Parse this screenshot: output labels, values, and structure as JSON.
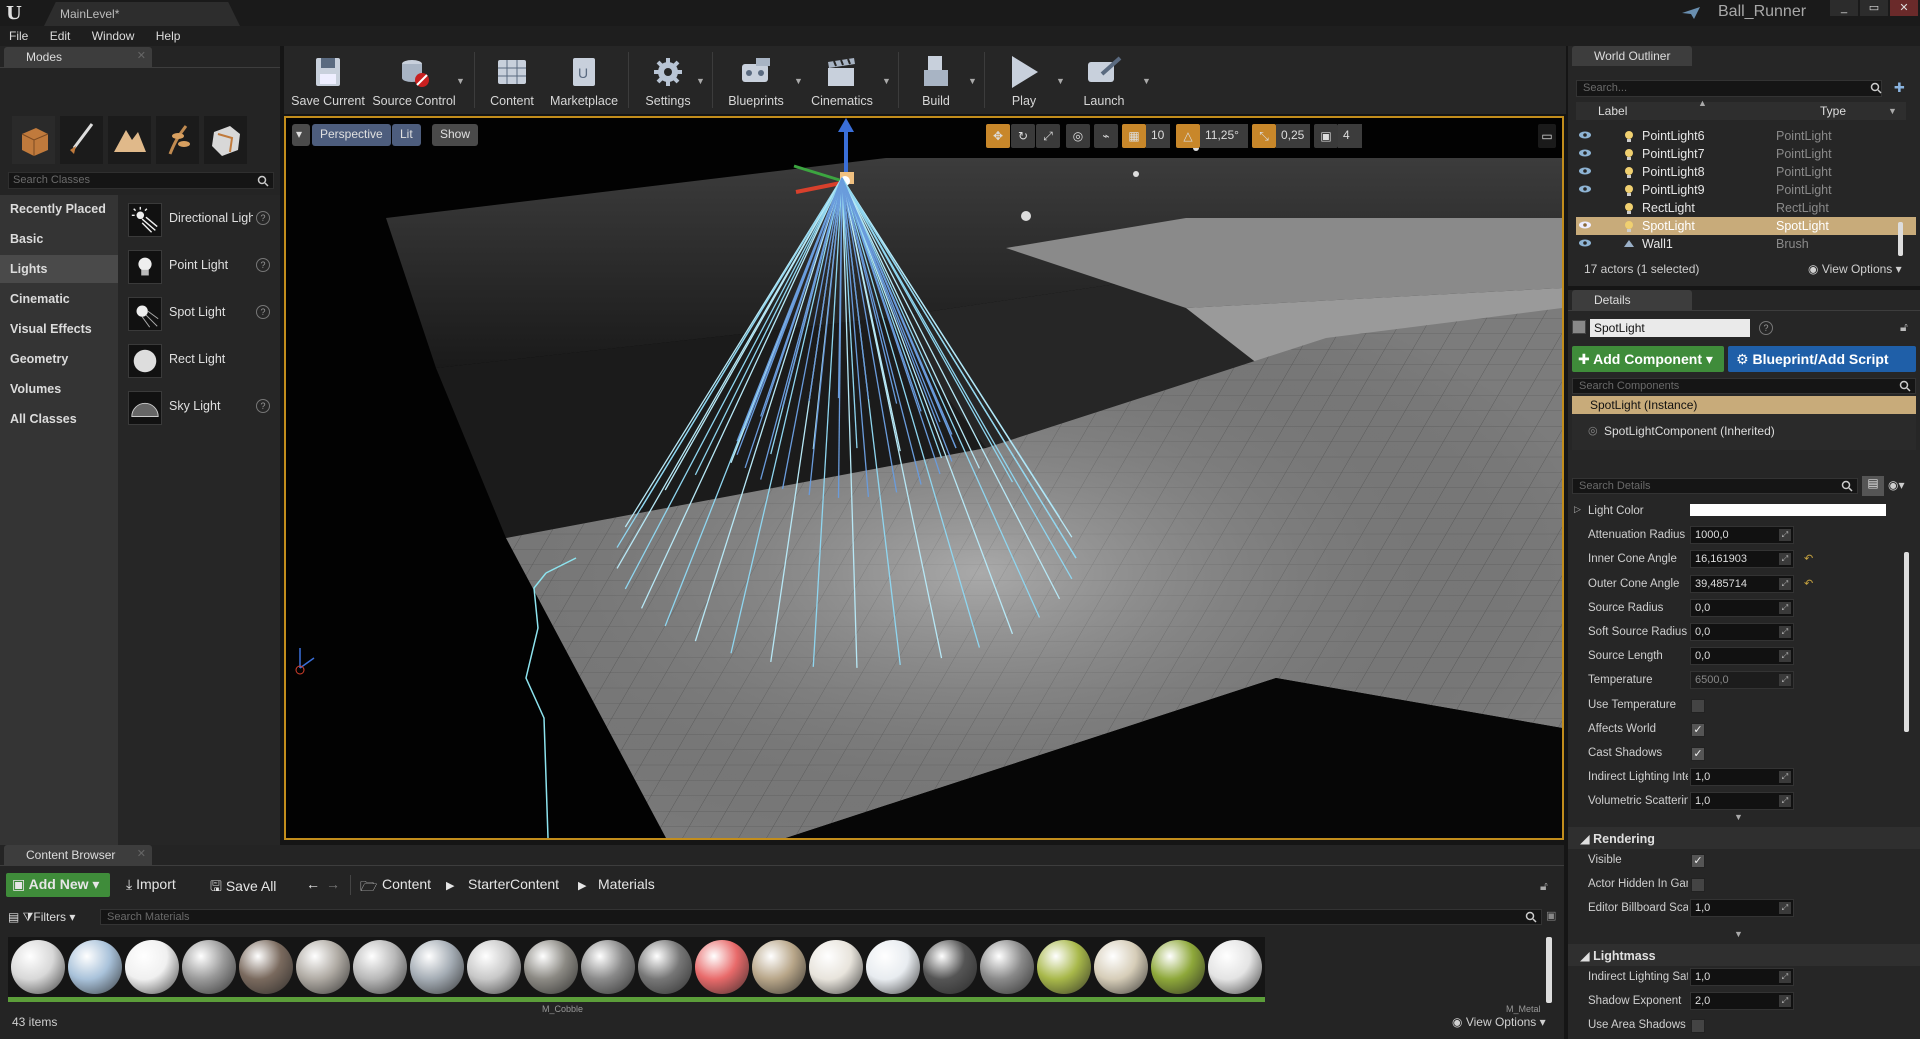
{
  "titlebar": {
    "level_tab": "MainLevel*",
    "project": "Ball_Runner",
    "minimize": "_",
    "maximize": "▭",
    "close": "✕"
  },
  "menu": [
    "File",
    "Edit",
    "Window",
    "Help"
  ],
  "modes": {
    "tab": "Modes",
    "search_placeholder": "Search Classes",
    "categories": [
      "Recently Placed",
      "Basic",
      "Lights",
      "Cinematic",
      "Visual Effects",
      "Geometry",
      "Volumes",
      "All Classes"
    ],
    "active_category": "Lights",
    "items": [
      "Directional Light",
      "Point Light",
      "Spot Light",
      "Rect Light",
      "Sky Light"
    ]
  },
  "toolbar": {
    "buttons": [
      "Save Current",
      "Source Control",
      "Content",
      "Marketplace",
      "Settings",
      "Blueprints",
      "Cinematics",
      "Build",
      "Play",
      "Launch"
    ]
  },
  "viewport": {
    "perspective": "Perspective",
    "lit": "Lit",
    "show": "Show",
    "grid_snap": "10",
    "rot_snap": "11,25°",
    "scale_snap": "0,25",
    "cam_speed": "4"
  },
  "outliner": {
    "tab": "World Outliner",
    "search_placeholder": "Search...",
    "col_label": "Label",
    "col_type": "Type",
    "rows": [
      {
        "label": "PointLight6",
        "type": "PointLight",
        "selected": false
      },
      {
        "label": "PointLight7",
        "type": "PointLight",
        "selected": false
      },
      {
        "label": "PointLight8",
        "type": "PointLight",
        "selected": false
      },
      {
        "label": "PointLight9",
        "type": "PointLight",
        "selected": false
      },
      {
        "label": "RectLight",
        "type": "RectLight",
        "selected": false
      },
      {
        "label": "SpotLight",
        "type": "SpotLight",
        "selected": true
      },
      {
        "label": "Wall1",
        "type": "Brush",
        "selected": false
      }
    ],
    "status": "17 actors (1 selected)",
    "view_options": "View Options"
  },
  "details": {
    "tab": "Details",
    "name": "SpotLight",
    "add_component": "Add Component",
    "blueprint": "Blueprint/Add Script",
    "search_components": "Search Components",
    "instance": "SpotLight (Instance)",
    "component": "SpotLightComponent (Inherited)",
    "search_details": "Search Details",
    "light_props": [
      {
        "label": "Light Color",
        "kind": "color"
      },
      {
        "label": "Attenuation Radius",
        "kind": "num",
        "value": "1000,0"
      },
      {
        "label": "Inner Cone Angle",
        "kind": "num",
        "value": "16,161903",
        "reset": true
      },
      {
        "label": "Outer Cone Angle",
        "kind": "num",
        "value": "39,485714",
        "reset": true
      },
      {
        "label": "Source Radius",
        "kind": "num",
        "value": "0,0"
      },
      {
        "label": "Soft Source Radius",
        "kind": "num",
        "value": "0,0"
      },
      {
        "label": "Source Length",
        "kind": "num",
        "value": "0,0"
      },
      {
        "label": "Temperature",
        "kind": "num",
        "value": "6500,0",
        "dim": true
      },
      {
        "label": "Use Temperature",
        "kind": "check",
        "checked": false
      },
      {
        "label": "Affects World",
        "kind": "check",
        "checked": true
      },
      {
        "label": "Cast Shadows",
        "kind": "check",
        "checked": true
      },
      {
        "label": "Indirect Lighting Inte",
        "kind": "num",
        "value": "1,0"
      },
      {
        "label": "Volumetric Scatterin",
        "kind": "num",
        "value": "1,0"
      }
    ],
    "rendering_title": "Rendering",
    "rendering_props": [
      {
        "label": "Visible",
        "kind": "check",
        "checked": true
      },
      {
        "label": "Actor Hidden In Gam",
        "kind": "check",
        "checked": false
      },
      {
        "label": "Editor Billboard Scal",
        "kind": "num",
        "value": "1,0"
      }
    ],
    "lightmass_title": "Lightmass",
    "lightmass_props": [
      {
        "label": "Indirect Lighting Sat",
        "kind": "num",
        "value": "1,0"
      },
      {
        "label": "Shadow Exponent",
        "kind": "num",
        "value": "2,0"
      },
      {
        "label": "Use Area Shadows f",
        "kind": "check",
        "checked": false
      }
    ]
  },
  "content_browser": {
    "tab": "Content Browser",
    "add_new": "Add New",
    "import": "Import",
    "save_all": "Save All",
    "path": [
      "Content",
      "StarterContent",
      "Materials"
    ],
    "filters": "Filters",
    "search_placeholder": "Search Materials",
    "items_count": "43 items",
    "view_options": "View Options",
    "visible_asset_labels": [
      "M_Cobble",
      "M_Metal"
    ],
    "asset_colors": [
      "#d8d8d8",
      "#a9c2da",
      "#f0f0f0",
      "#9a9a9a",
      "#7a6a5e",
      "#b0aba4",
      "#b8b8b8",
      "#a5adb5",
      "#c8c8c8",
      "#8c8a84",
      "#8a8a8a",
      "#777",
      "#e86a6a",
      "#b8a689",
      "#e8e4dc",
      "#e8ecf0",
      "#555",
      "#8a8a8a",
      "#a8b84a",
      "#d6cdb8",
      "#8ea83a",
      "#e4e4e4"
    ]
  }
}
